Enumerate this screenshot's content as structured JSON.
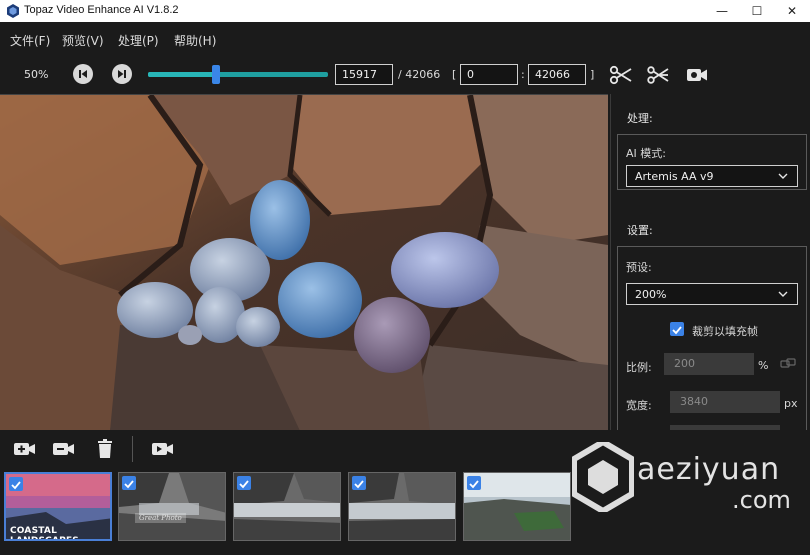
{
  "window": {
    "title": "Topaz Video Enhance AI V1.8.2",
    "minimize": "—",
    "maximize": "☐",
    "close": "✕"
  },
  "menu": {
    "items": [
      "文件(F)",
      "预览(V)",
      "处理(P)",
      "帮助(H)"
    ]
  },
  "toolbar": {
    "zoom": "50%",
    "timeline_progress": 0.38,
    "current_frame": "15917",
    "total_frames": "/ 42066",
    "range_open": "[",
    "range_start": "0",
    "range_sep": ":",
    "range_end": "42066",
    "range_close": "]",
    "icons": [
      "prev-frame-icon",
      "next-frame-icon",
      "scissors-icon",
      "split-icon",
      "video-camera-icon"
    ],
    "accent": "#28b6b8"
  },
  "right_panel": {
    "processing_title": "处理:",
    "ai_mode_label": "AI 模式:",
    "ai_mode_value": "Artemis AA v9",
    "settings_title": "设置:",
    "preset_label": "预设:",
    "preset_value": "200%",
    "crop_label": "裁剪以填充帧",
    "crop_checked": true,
    "scale_label": "比例:",
    "scale_value": "200",
    "scale_unit": "%",
    "width_label": "宽度:",
    "width_value": "3840",
    "width_unit": "px"
  },
  "bottom_toolbar": {
    "icons": [
      "add-video-icon",
      "remove-video-icon",
      "trash-icon",
      "export-video-icon"
    ]
  },
  "thumbnails": [
    {
      "caption": "COASTAL LANDSCAPES",
      "checked": true,
      "selected": true
    },
    {
      "caption": "Great Photo",
      "checked": true,
      "selected": false
    },
    {
      "caption": "",
      "checked": true,
      "selected": false
    },
    {
      "caption": "",
      "checked": true,
      "selected": false
    },
    {
      "caption": "",
      "checked": true,
      "selected": false
    }
  ],
  "watermark": {
    "line1": "aeziyuan",
    "line2": ".com"
  }
}
